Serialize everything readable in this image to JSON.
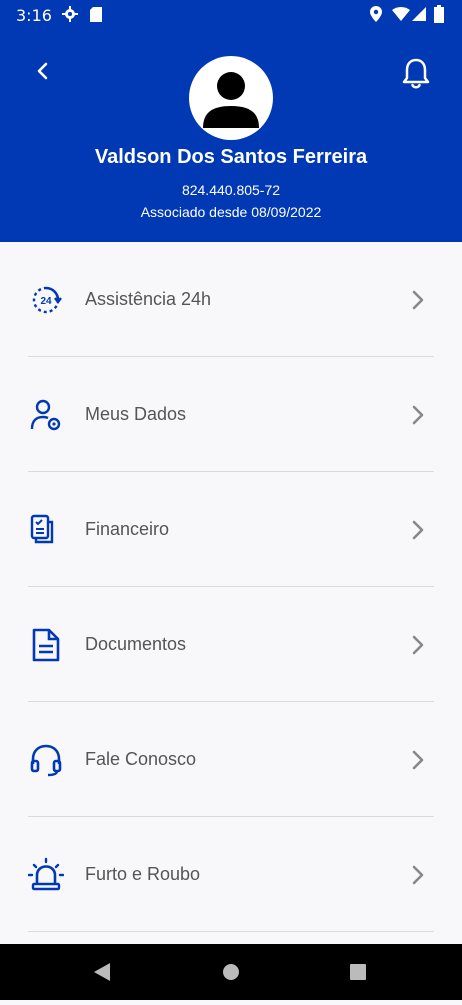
{
  "status_bar": {
    "time": "3:16"
  },
  "profile": {
    "name": "Valdson Dos Santos Ferreira",
    "cpf": "824.440.805-72",
    "member_since": "Associado desde 08/09/2022"
  },
  "menu": {
    "items": [
      {
        "label": "Assistência 24h",
        "icon": "clock-24h-icon",
        "icon_text": "24"
      },
      {
        "label": "Meus Dados",
        "icon": "user-settings-icon"
      },
      {
        "label": "Financeiro",
        "icon": "receipt-icon"
      },
      {
        "label": "Documentos",
        "icon": "document-icon"
      },
      {
        "label": "Fale Conosco",
        "icon": "headset-icon"
      },
      {
        "label": "Furto e Roubo",
        "icon": "alarm-light-icon"
      }
    ]
  },
  "colors": {
    "primary": "#0039b3",
    "background": "#f8f8fb",
    "text": "#555555",
    "chevron": "#888888"
  }
}
